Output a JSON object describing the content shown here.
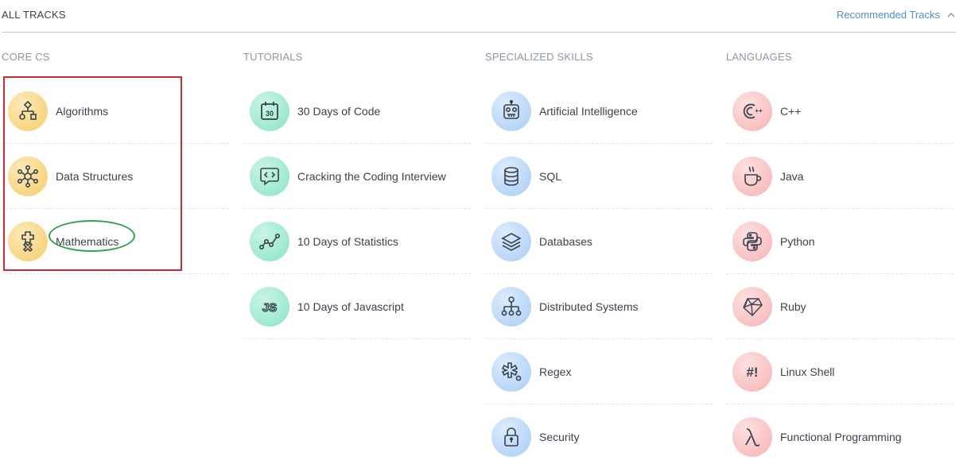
{
  "header": {
    "title": "ALL TRACKS",
    "toggle_label": "Recommended Tracks",
    "toggle_icon": "chevron-up-icon"
  },
  "colors": {
    "accent": "#4a90d9",
    "annotation_box": "#cc2a36",
    "annotation_ellipse": "#31a051"
  },
  "columns": [
    {
      "heading": "CORE CS",
      "tracks": [
        {
          "label": "Algorithms",
          "icon": "algorithm-flowchart-icon"
        },
        {
          "label": "Data Structures",
          "icon": "network-nodes-icon"
        },
        {
          "label": "Mathematics",
          "icon": "math-operators-icon"
        }
      ]
    },
    {
      "heading": "TUTORIALS",
      "tracks": [
        {
          "label": "30 Days of Code",
          "icon": "calendar-30-icon",
          "icon_text": "30"
        },
        {
          "label": "Cracking the Coding Interview",
          "icon": "code-chat-icon"
        },
        {
          "label": "10 Days of Statistics",
          "icon": "line-graph-icon"
        },
        {
          "label": "10 Days of Javascript",
          "icon": "js-icon",
          "icon_text": "JS"
        }
      ]
    },
    {
      "heading": "SPECIALIZED SKILLS",
      "tracks": [
        {
          "label": "Artificial Intelligence",
          "icon": "robot-icon"
        },
        {
          "label": "SQL",
          "icon": "database-stack-icon"
        },
        {
          "label": "Databases",
          "icon": "layers-icon"
        },
        {
          "label": "Distributed Systems",
          "icon": "hierarchy-icon"
        },
        {
          "label": "Regex",
          "icon": "asterisk-dot-icon"
        },
        {
          "label": "Security",
          "icon": "padlock-icon"
        }
      ]
    },
    {
      "heading": "LANGUAGES",
      "tracks": [
        {
          "label": "C++",
          "icon": "cpp-icon",
          "icon_text": "++"
        },
        {
          "label": "Java",
          "icon": "coffee-cup-icon"
        },
        {
          "label": "Python",
          "icon": "python-logo-icon"
        },
        {
          "label": "Ruby",
          "icon": "ruby-gem-icon"
        },
        {
          "label": "Linux Shell",
          "icon": "shell-hash-icon",
          "icon_text": "#!"
        },
        {
          "label": "Functional Programming",
          "icon": "lambda-icon"
        }
      ]
    }
  ]
}
